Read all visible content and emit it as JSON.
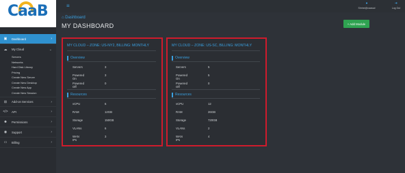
{
  "logo": "CaaB",
  "sidebar": {
    "items": [
      {
        "label": "Dashboard",
        "icon": "home-icon",
        "glyph": "▣"
      },
      {
        "label": "My Cloud",
        "icon": "cloud-icon",
        "glyph": "☁"
      },
      {
        "label": "Add-on Services",
        "icon": "puzzle-icon",
        "glyph": "⊞"
      },
      {
        "label": "API",
        "icon": "code-icon",
        "glyph": "</>"
      },
      {
        "label": "Permissions",
        "icon": "users-icon",
        "glyph": "☻"
      },
      {
        "label": "Support",
        "icon": "lifebuoy-icon",
        "glyph": "◉"
      },
      {
        "label": "Billing",
        "icon": "card-icon",
        "glyph": "▭"
      }
    ],
    "submenu": [
      "Servers",
      "Networks",
      "Hard Disk Library",
      "Pricing",
      "Create New Server",
      "Create New Desktop",
      "Create New App",
      "Create New Session"
    ]
  },
  "topbar": {
    "user_label": "Shrine@caasud",
    "logout_label": "Log Out"
  },
  "header": {
    "breadcrumb": "Dashboard",
    "title": "MY DASHBOARD",
    "add_module": "+ Add Module"
  },
  "panels": [
    {
      "title": "MY CLOUD – ZONE: US-NY2, BILLING: MONTHLY",
      "overview_label": "Overview",
      "overview": [
        {
          "k": "Servers",
          "v": "3"
        },
        {
          "k": "Powered On",
          "v": "3"
        },
        {
          "k": "Powered Off",
          "v": "0"
        }
      ],
      "resources_label": "Resources",
      "resources": [
        {
          "k": "vCPU",
          "v": "6"
        },
        {
          "k": "RAM",
          "v": "12GB"
        },
        {
          "k": "Storage",
          "v": "150GB"
        },
        {
          "k": "VLANs",
          "v": "6"
        },
        {
          "k": "WAN IPs",
          "v": "3"
        }
      ]
    },
    {
      "title": "MY CLOUD – ZONE: US-SC, BILLING: MONTHLY",
      "overview_label": "Overview",
      "overview": [
        {
          "k": "Servers",
          "v": "5"
        },
        {
          "k": "Powered On",
          "v": "5"
        },
        {
          "k": "Powered Off",
          "v": "0"
        }
      ],
      "resources_label": "Resources",
      "resources": [
        {
          "k": "vCPU",
          "v": "12"
        },
        {
          "k": "RAM",
          "v": "26GB"
        },
        {
          "k": "Storage",
          "v": "720GB"
        },
        {
          "k": "VLANs",
          "v": "2"
        },
        {
          "k": "WAN IPs",
          "v": "4"
        }
      ]
    }
  ]
}
